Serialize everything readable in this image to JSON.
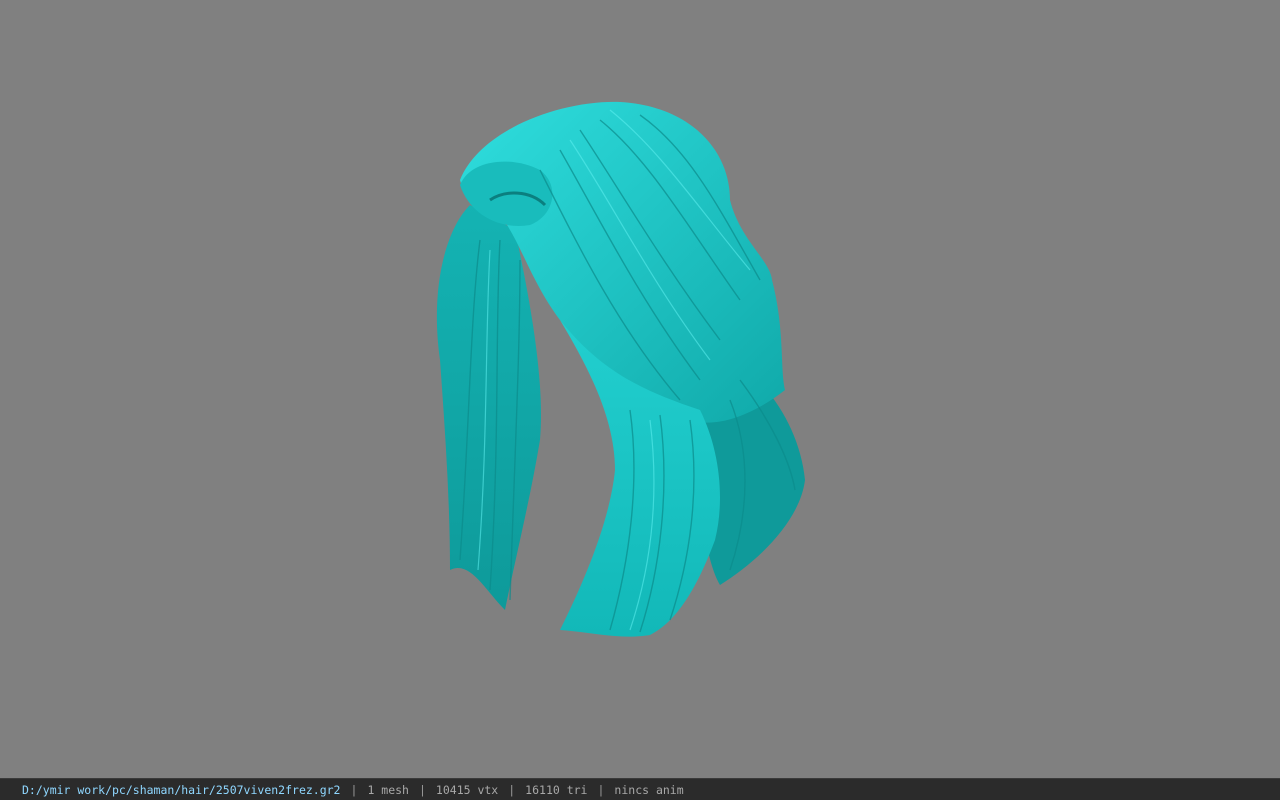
{
  "viewport": {
    "background": "#808080",
    "model_color": "#1fc7c7",
    "model_shadow": "#0d8e8e",
    "model_highlight": "#3fe3e3"
  },
  "status": {
    "file_path": "D:/ymir work/pc/shaman/hair/2507viven2frez.gr2",
    "separator": "|",
    "mesh_count": "1 mesh",
    "vertex_count": "10415 vtx",
    "triangle_count": "16110 tri",
    "anim_status": "nincs anim"
  }
}
